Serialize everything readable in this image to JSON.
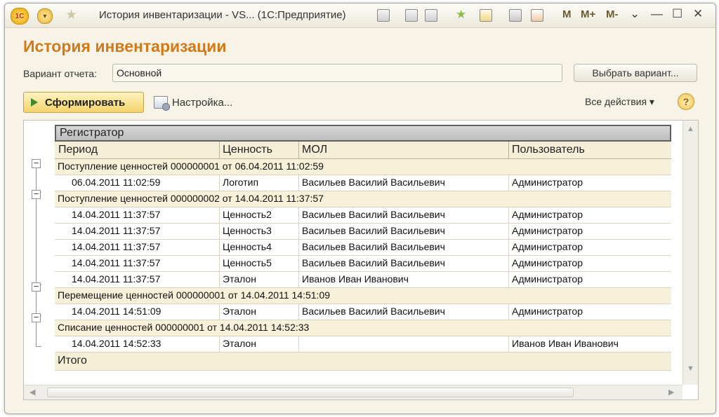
{
  "titlebar": {
    "logo": "1С",
    "title": "История инвентаризации - VS...  (1С:Предприятие)",
    "icons": [
      "save-icon",
      "print-icon",
      "print-preview-icon",
      "favorites-add-icon",
      "bookmark-icon",
      "calculator-icon",
      "calendar-icon"
    ],
    "memory_buttons": [
      "M",
      "M+",
      "M-"
    ],
    "window_controls": {
      "dropdown": "⌄",
      "minimize": "—",
      "maximize": "☐",
      "close": "✕"
    }
  },
  "form": {
    "title": "История инвентаризации",
    "variant_label": "Вариант отчета:",
    "variant_value": "Основной",
    "select_variant_button": "Выбрать вариант...",
    "generate_button": "Сформировать",
    "settings_button": "Настройка...",
    "all_actions": "Все действия ▾",
    "help": "?"
  },
  "report": {
    "registrar_header": "Регистратор",
    "columns": [
      "Период",
      "Ценность",
      "МОЛ",
      "Пользователь"
    ],
    "groups": [
      {
        "title": "Поступление ценностей 000000001 от 06.04.2011 11:02:59",
        "rows": [
          [
            "06.04.2011 11:02:59",
            "Логотип",
            "Васильев Василий Васильевич",
            "Администратор"
          ]
        ]
      },
      {
        "title": "Поступление ценностей 000000002 от 14.04.2011 11:37:57",
        "rows": [
          [
            "14.04.2011 11:37:57",
            "Ценность2",
            "Васильев Василий Васильевич",
            "Администратор"
          ],
          [
            "14.04.2011 11:37:57",
            "Ценность3",
            "Васильев Василий Васильевич",
            "Администратор"
          ],
          [
            "14.04.2011 11:37:57",
            "Ценность4",
            "Васильев Василий Васильевич",
            "Администратор"
          ],
          [
            "14.04.2011 11:37:57",
            "Ценность5",
            "Васильев Василий Васильевич",
            "Администратор"
          ],
          [
            "14.04.2011 11:37:57",
            "Эталон",
            "Иванов Иван Иванович",
            "Администратор"
          ]
        ]
      },
      {
        "title": "Перемещение ценностей 000000001 от 14.04.2011 14:51:09",
        "rows": [
          [
            "14.04.2011 14:51:09",
            "Эталон",
            "Васильев Василий Васильевич",
            "Администратор"
          ]
        ]
      },
      {
        "title": "Списание ценностей 000000001 от 14.04.2011 14:52:33",
        "rows": [
          [
            "14.04.2011 14:52:33",
            "Эталон",
            "",
            "Иванов Иван Иванович"
          ]
        ]
      }
    ],
    "total_label": "Итого"
  }
}
